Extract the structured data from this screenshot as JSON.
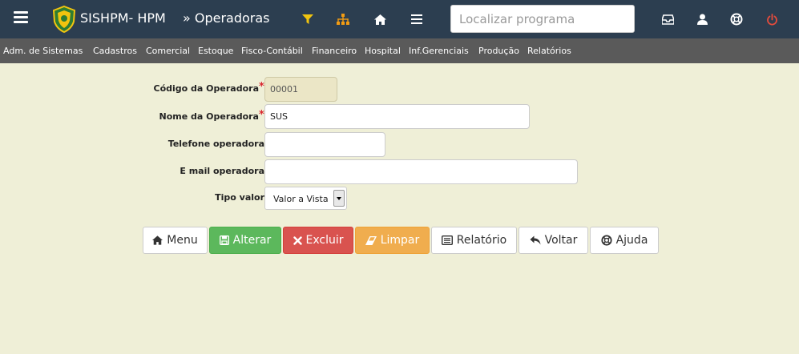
{
  "header": {
    "app_title": "SISHPM- HPM",
    "breadcrumb": "» Operadoras",
    "search_placeholder": "Localizar programa",
    "icons": [
      "menu-icon",
      "logo",
      "filter-icon",
      "sitemap-icon",
      "home-icon",
      "list-icon",
      "inbox-icon",
      "user-icon",
      "lifebuoy-icon",
      "power-icon"
    ],
    "bar_color": "#2c3e50"
  },
  "menu": {
    "items": [
      "Adm. de Sistemas",
      "Cadastros",
      "Comercial",
      "Estoque",
      "Fisco-Contábil",
      "Financeiro",
      "Hospital",
      "Inf.Gerenciais",
      "Produção",
      "Relatórios"
    ]
  },
  "form": {
    "codigo": {
      "label": "Código da Operadora",
      "value": "00001",
      "required": "*"
    },
    "nome": {
      "label": "Nome da Operadora",
      "value": "SUS",
      "required": "*"
    },
    "telefone": {
      "label": "Telefone operadora",
      "value": ""
    },
    "email": {
      "label": "E mail operadora",
      "value": ""
    },
    "tipo": {
      "label": "Tipo valor",
      "selected": "Valor a Vista"
    }
  },
  "buttons": {
    "menu": "Menu",
    "alterar": "Alterar",
    "excluir": "Excluir",
    "limpar": "Limpar",
    "relatorio": "Relatório",
    "voltar": "Voltar",
    "ajuda": "Ajuda"
  },
  "colors": {
    "background": "#efefd7",
    "menubar": "#5a5a5a",
    "success": "#5cb85c",
    "danger": "#d9534f",
    "warning": "#f0ad4e",
    "power": "#e74c3c",
    "filter": "#f1c40f"
  }
}
